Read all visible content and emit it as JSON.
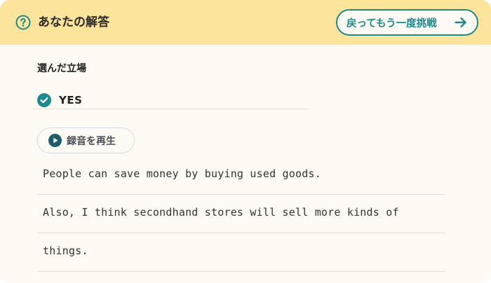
{
  "header": {
    "title": "あなたの解答",
    "retry_label": "戻ってもう一度挑戦",
    "help_icon": "question-circle-icon",
    "retry_icon": "arrow-right-icon"
  },
  "stance": {
    "section_title": "選んだ立場",
    "value": "YES",
    "icon": "check-circle-icon"
  },
  "recording": {
    "play_label": "録音を再生",
    "icon": "play-circle-icon"
  },
  "answer": {
    "lines": [
      "People can save money by buying used goods.",
      "Also, I think secondhand stores will sell more kinds of",
      "things."
    ]
  },
  "colors": {
    "header_bg": "#fce49a",
    "accent": "#1a8a8f",
    "card_bg": "#fffaf3"
  }
}
